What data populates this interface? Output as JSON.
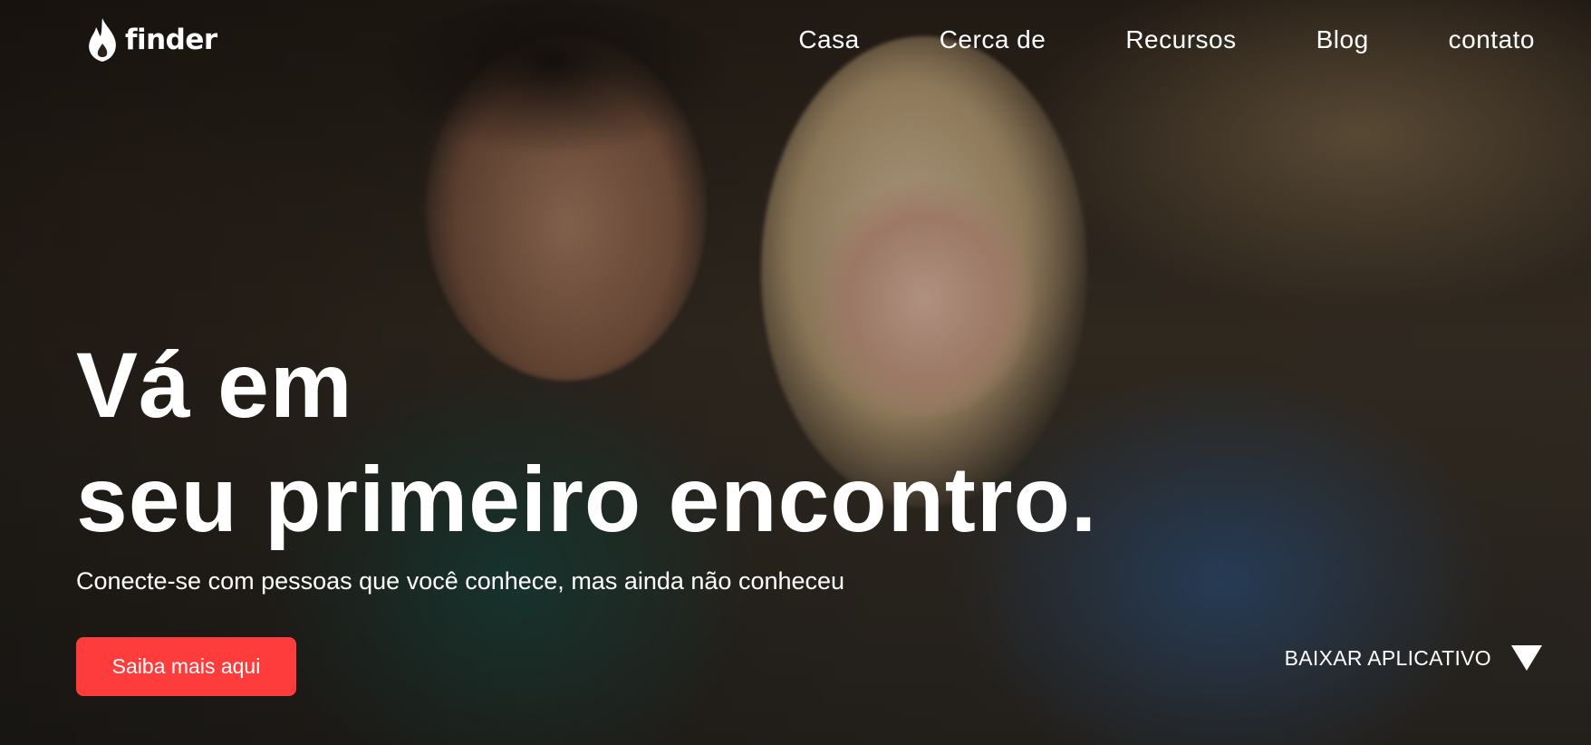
{
  "brand": {
    "name": "finder",
    "logo_icon": "flame-icon"
  },
  "nav": {
    "items": [
      {
        "label": "Casa"
      },
      {
        "label": "Cerca de"
      },
      {
        "label": "Recursos"
      },
      {
        "label": "Blog"
      },
      {
        "label": "contato"
      }
    ]
  },
  "hero": {
    "headline_line1": "Vá em",
    "headline_line2": "seu primeiro encontro.",
    "subtitle": "Conecte-se com pessoas que você conhece, mas ainda não conheceu",
    "cta_label": "Saiba mais aqui",
    "download_label": "BAIXAR APLICATIVO",
    "download_icon": "triangle-down-icon"
  },
  "colors": {
    "accent": "#ff3c3c",
    "text": "#ffffff"
  }
}
